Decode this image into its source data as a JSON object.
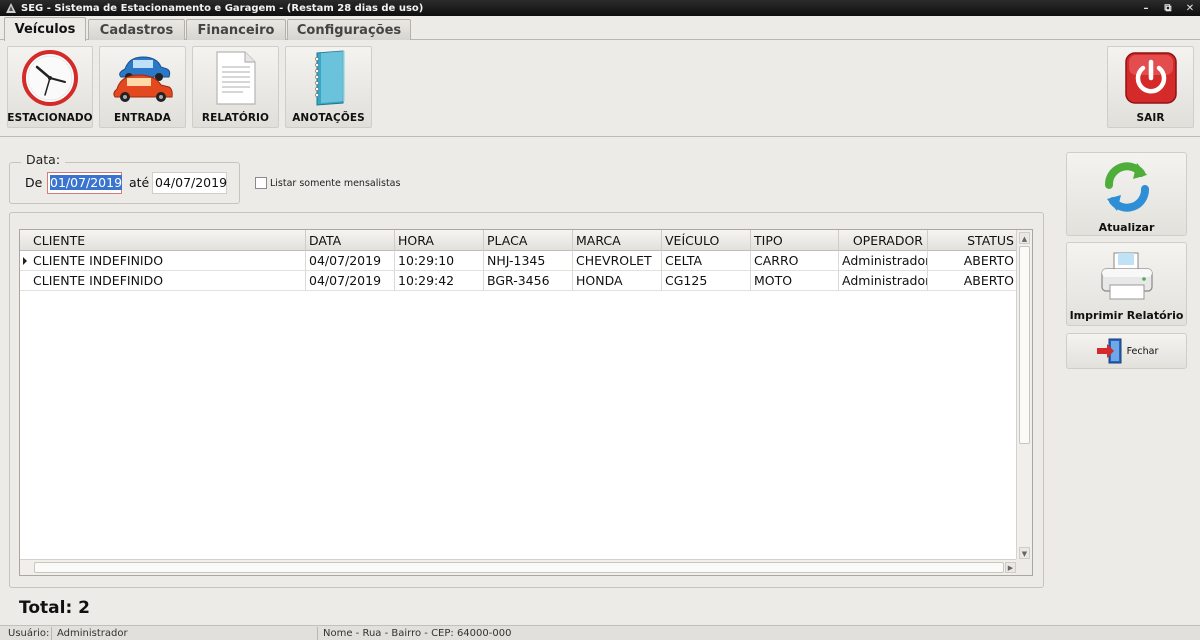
{
  "window": {
    "title": "SEG - Sistema de Estacionamento e Garagem  - (Restam 28 dias de uso)",
    "controls": [
      "–",
      "⧉",
      "✕"
    ]
  },
  "tabs": [
    {
      "label": "Veículos",
      "active": true
    },
    {
      "label": "Cadastros",
      "active": false
    },
    {
      "label": "Financeiro",
      "active": false
    },
    {
      "label": "Configurações",
      "active": false
    }
  ],
  "ribbon": {
    "estacionado": "ESTACIONADO",
    "entrada": "ENTRADA",
    "relatorio": "RELATÓRIO",
    "anotacoes": "ANOTAÇÕES",
    "sair": "SAIR"
  },
  "filter": {
    "group_label": "Data:",
    "from_label": "De",
    "from_value": "01/07/2019",
    "to_label": "até",
    "to_value": "04/07/2019",
    "checkbox_label": "Listar somente mensalistas",
    "checkbox_checked": false
  },
  "grid": {
    "columns": [
      "CLIENTE",
      "DATA",
      "HORA",
      "PLACA",
      "MARCA",
      "VEÍCULO",
      "TIPO",
      "OPERADOR",
      "STATUS"
    ],
    "rows": [
      [
        "CLIENTE INDEFINIDO",
        "04/07/2019",
        "10:29:10",
        "NHJ-1345",
        "CHEVROLET",
        "CELTA",
        "CARRO",
        "Administrador",
        "ABERTO"
      ],
      [
        "CLIENTE INDEFINIDO",
        "04/07/2019",
        "10:29:42",
        "BGR-3456",
        "HONDA",
        "CG125",
        "MOTO",
        "Administrador",
        "ABERTO"
      ]
    ]
  },
  "side_buttons": {
    "atualizar": "Atualizar",
    "imprimir": "Imprimir Relatório",
    "fechar": "Fechar"
  },
  "total": "Total: 2",
  "statusbar": {
    "user_label": "Usuário:",
    "user_value": "Administrador",
    "address": "Nome - Rua - Bairro - CEP: 64000-000"
  },
  "colors": {
    "accent_red": "#d42a2a",
    "selection_blue": "#3a74cf",
    "refresh_green": "#4fae3a",
    "refresh_blue": "#2f8fd6"
  },
  "icons": [
    "clock-icon",
    "cars-icon",
    "document-icon",
    "notebook-icon",
    "power-icon",
    "refresh-icon",
    "printer-icon",
    "exit-door-icon"
  ]
}
